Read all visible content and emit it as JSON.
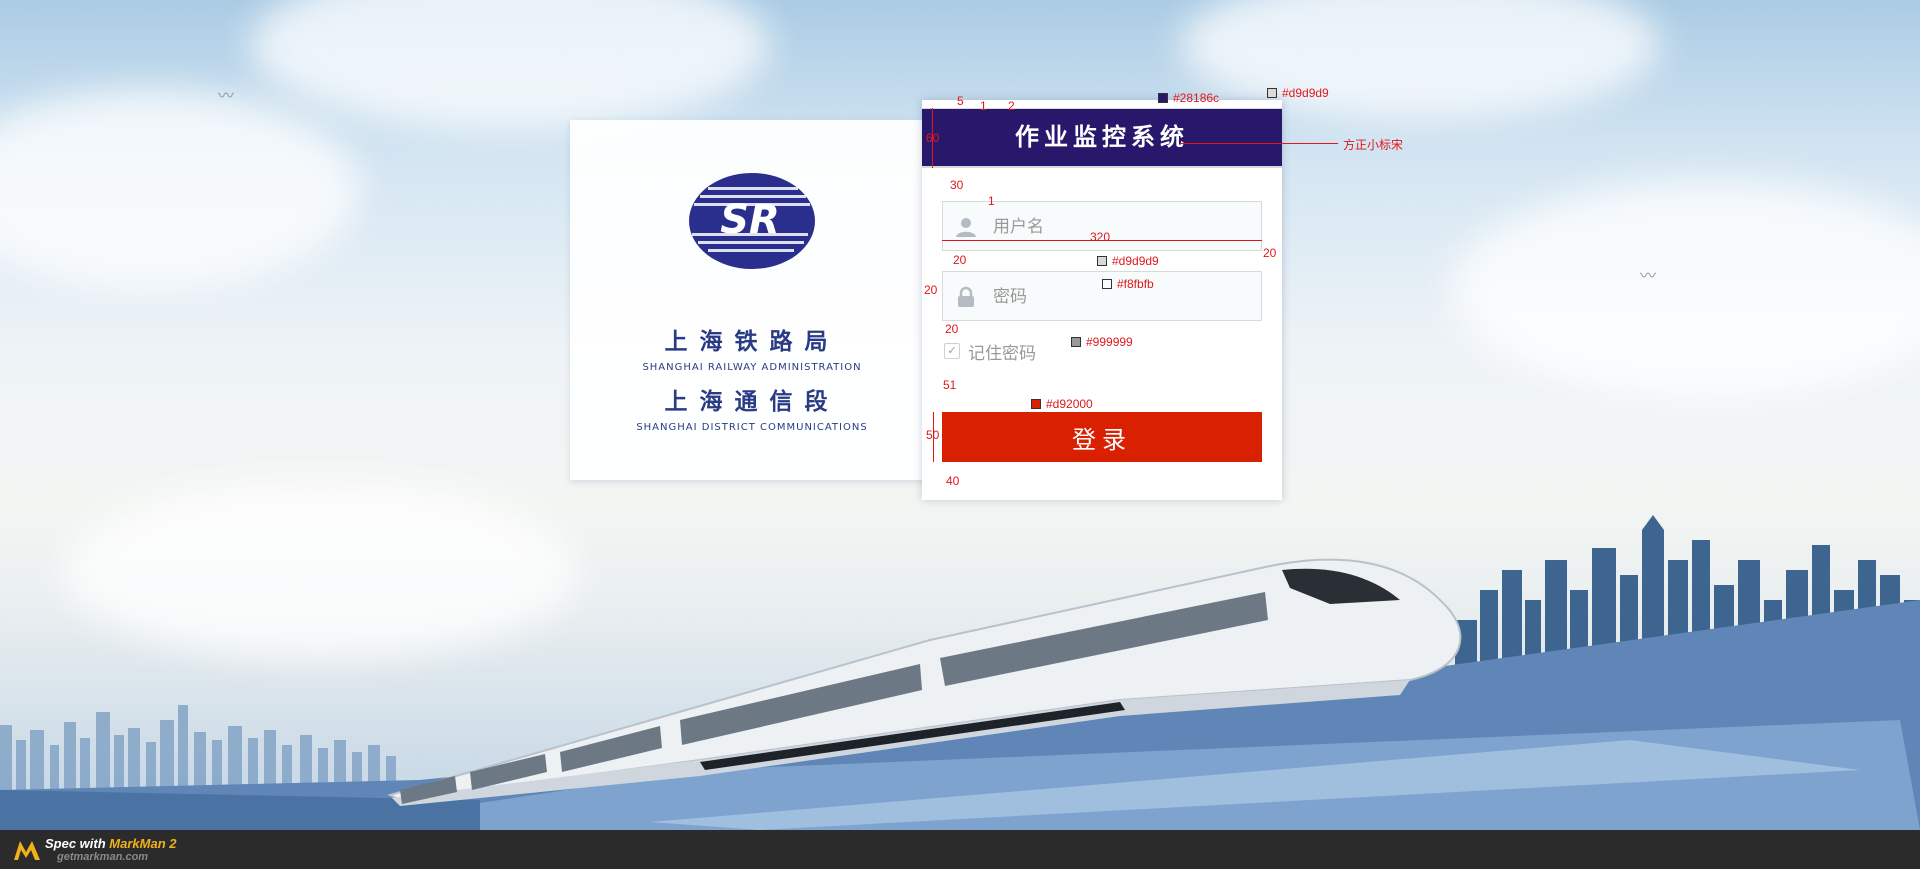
{
  "login": {
    "title": "作业监控系统",
    "username_placeholder": "用户名",
    "password_placeholder": "密码",
    "remember_label": "记住密码",
    "remember_checked": true,
    "submit_label": "登录"
  },
  "branding": {
    "logo_text": "SR",
    "bureau_cn": "上海铁路局",
    "bureau_en": "SHANGHAI RAILWAY ADMINISTRATION",
    "district_cn": "上海通信段",
    "district_en": "SHANGHAI DISTRICT COMMUNICATIONS"
  },
  "colors": {
    "header": "#28186c",
    "border": "#d9d9d9",
    "field_bg": "#f8fbfb",
    "placeholder": "#999999",
    "button": "#d92000"
  },
  "spec": {
    "header_color_label": "#28186c",
    "header_border_label": "#d9d9d9",
    "font_label": "方正小标宋",
    "gap_5": "5",
    "gap_1": "1",
    "gap_2": "2",
    "header_height": "60",
    "gap_30": "30",
    "field_border_px": "1",
    "field_width": "320",
    "pad_20_a": "20",
    "pad_20_b": "20",
    "pad_20_c": "20",
    "pad_20_d": "20",
    "field_border_label": "#d9d9d9",
    "field_bg_label": "#f8fbfb",
    "text_color_label": "#999999",
    "gap_51": "51",
    "button_color_label": "#d92000",
    "button_height": "50",
    "gap_40": "40"
  },
  "footer": {
    "prefix": "Spec with ",
    "product": "MarkMan 2",
    "url": "getmarkman.com"
  }
}
